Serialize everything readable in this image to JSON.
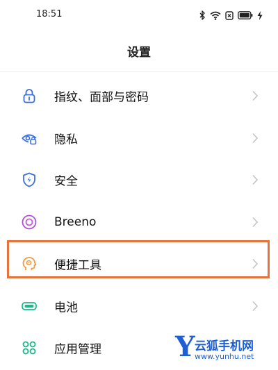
{
  "status_bar": {
    "time": "18:51",
    "icons": [
      "bluetooth-icon",
      "wifi-icon",
      "sim-icon",
      "battery-icon",
      "charging-icon"
    ]
  },
  "header": {
    "title": "设置"
  },
  "settings": {
    "items": [
      {
        "label": "指纹、面部与密码",
        "icon": "lock-icon",
        "icon_color": "#3b6fe0"
      },
      {
        "label": "隐私",
        "icon": "privacy-eye-icon",
        "icon_color": "#3b6fe0"
      },
      {
        "label": "安全",
        "icon": "shield-icon",
        "icon_color": "#3b6fe0"
      },
      {
        "label": "Breeno",
        "icon": "breeno-icon",
        "icon_color": "#b04fd6"
      },
      {
        "label": "便捷工具",
        "icon": "convenience-tools-icon",
        "icon_color": "#f39a3c",
        "highlighted": true
      },
      {
        "label": "电池",
        "icon": "battery-icon",
        "icon_color": "#19b98a"
      },
      {
        "label": "应用管理",
        "icon": "app-grid-icon",
        "icon_color": "#19b98a"
      }
    ]
  },
  "highlight_color": "#e8733a",
  "watermark": {
    "letter": "Y",
    "name": "云狐手机网",
    "url": "www.yunhu.net",
    "color": "#1d5fd6"
  }
}
